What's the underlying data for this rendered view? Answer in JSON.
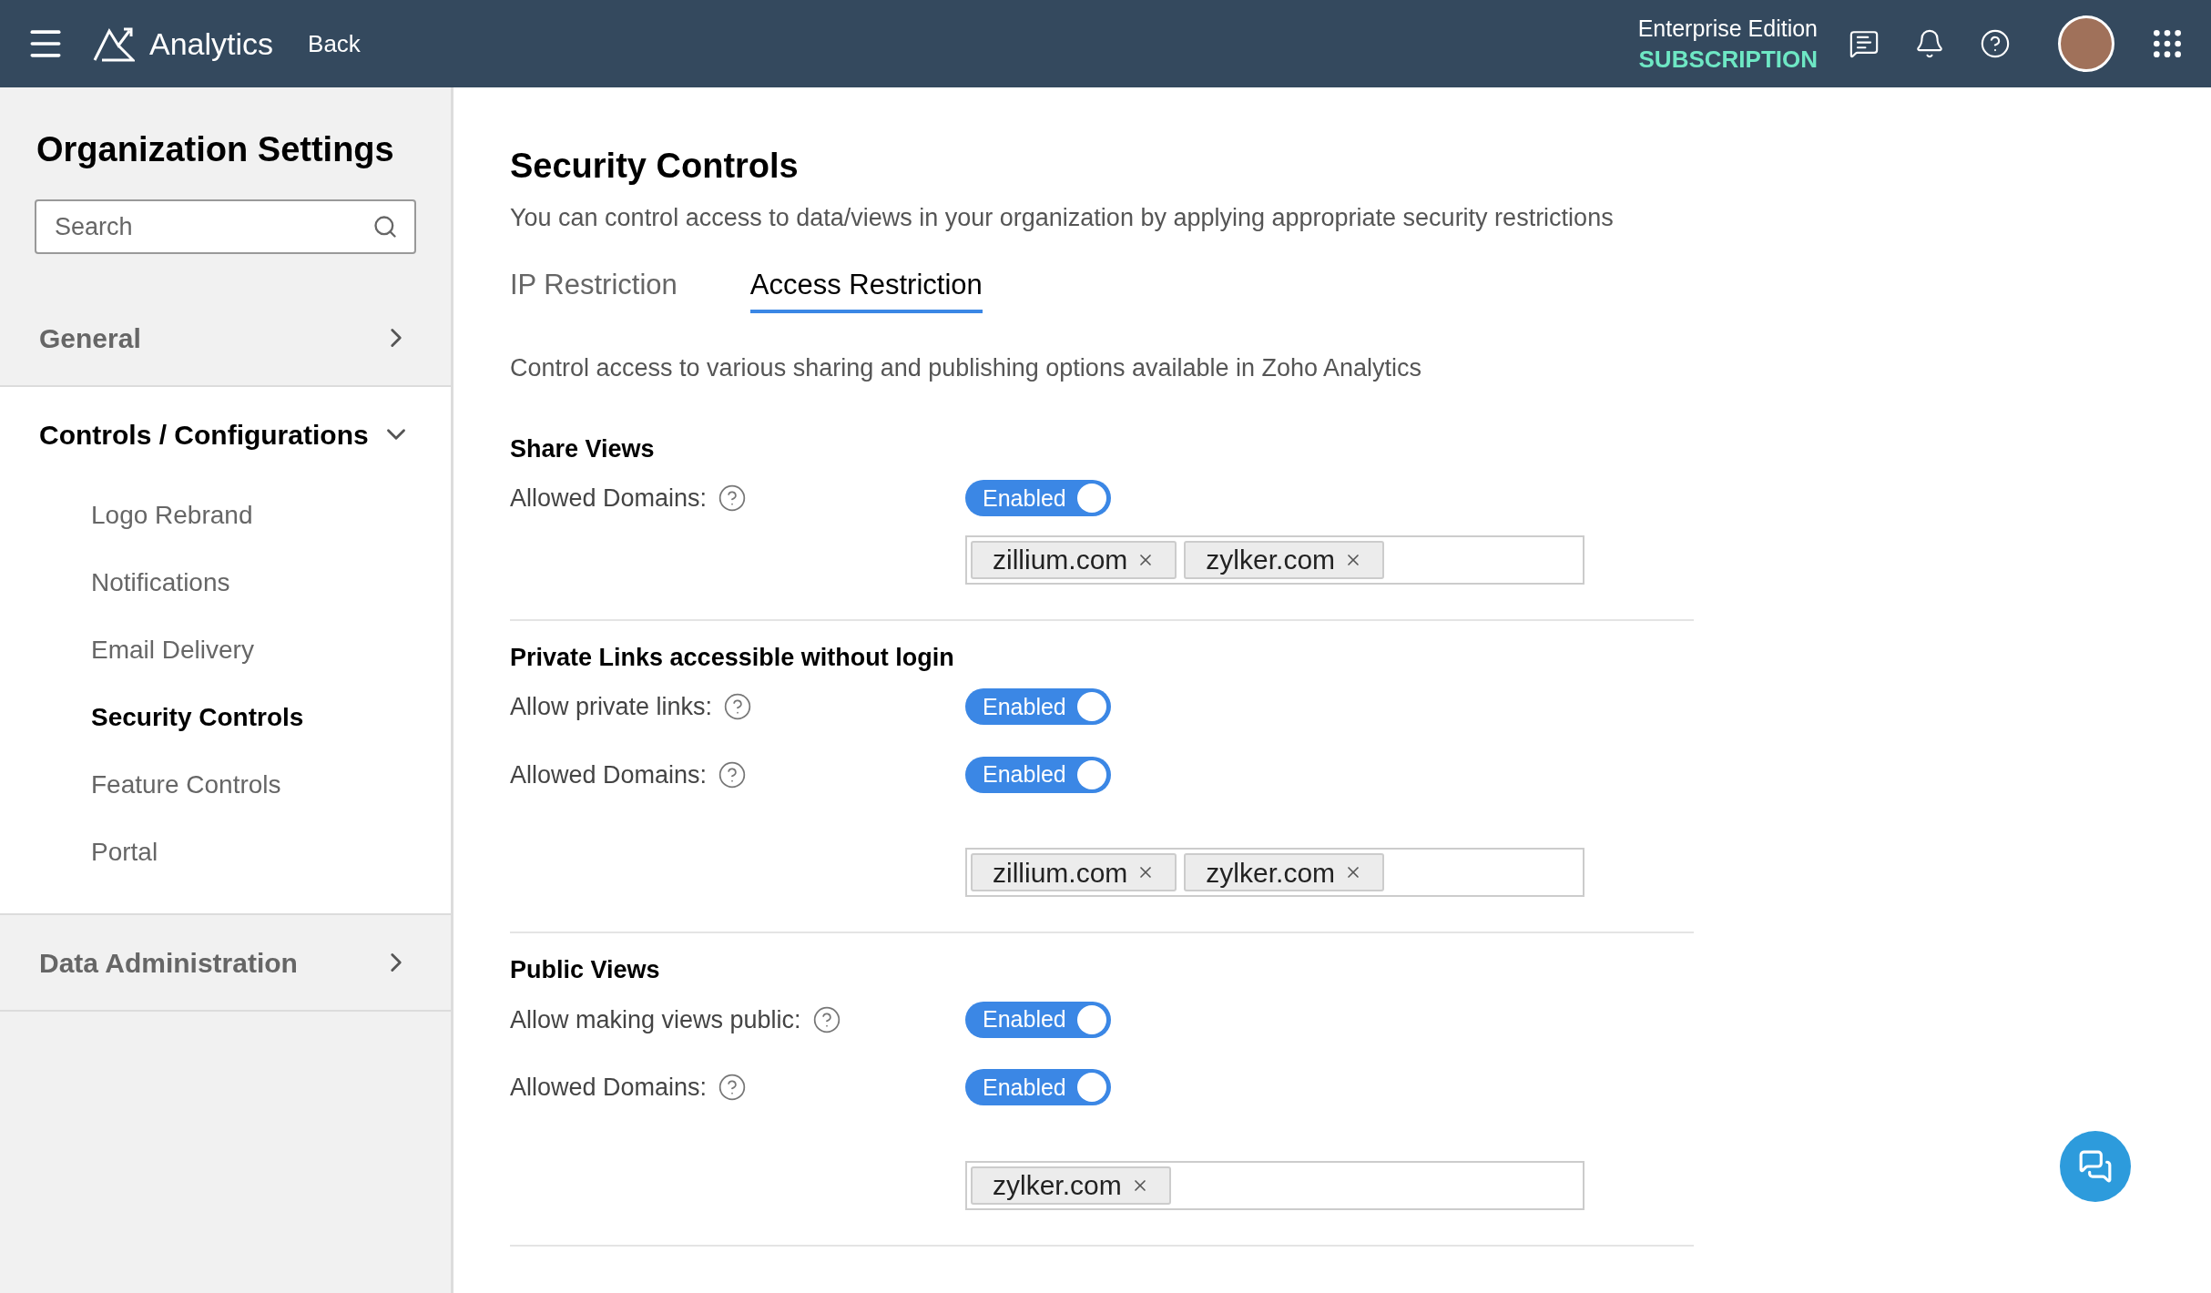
{
  "header": {
    "app_name": "Analytics",
    "back": "Back",
    "edition": "Enterprise Edition",
    "plan": "SUBSCRIPTION"
  },
  "sidebar": {
    "title": "Organization Settings",
    "search": {
      "placeholder": "Search"
    },
    "groups": [
      {
        "label": "General",
        "expanded": false
      },
      {
        "label": "Controls / Configurations",
        "expanded": true,
        "items": [
          {
            "label": "Logo Rebrand",
            "selected": false
          },
          {
            "label": "Notifications",
            "selected": false
          },
          {
            "label": "Email Delivery",
            "selected": false
          },
          {
            "label": "Security Controls",
            "selected": true
          },
          {
            "label": "Feature Controls",
            "selected": false
          },
          {
            "label": "Portal",
            "selected": false
          }
        ]
      },
      {
        "label": "Data Administration",
        "expanded": false
      }
    ]
  },
  "page": {
    "title": "Security Controls",
    "subtitle": "You can control access to data/views in your organization by applying appropriate security restrictions",
    "tabs": [
      {
        "label": "IP Restriction",
        "selected": false
      },
      {
        "label": "Access Restriction",
        "selected": true
      }
    ],
    "description": "Control access to various sharing and publishing options available in Zoho Analytics",
    "sections": [
      {
        "title": "Share Views",
        "rows": [
          {
            "label": "Allowed Domains:",
            "on": true,
            "toggle_text": "Enabled",
            "tags": [
              "zillium.com",
              "zylker.com"
            ]
          }
        ]
      },
      {
        "title": "Private Links accessible without login",
        "rows": [
          {
            "label": "Allow private links:",
            "on": true,
            "toggle_text": "Enabled"
          },
          {
            "label": "Allowed Domains:",
            "on": true,
            "toggle_text": "Enabled",
            "tags": [
              "zillium.com",
              "zylker.com"
            ]
          }
        ]
      },
      {
        "title": "Public Views",
        "rows": [
          {
            "label": "Allow making views public:",
            "on": true,
            "toggle_text": "Enabled"
          },
          {
            "label": "Allowed Domains:",
            "on": true,
            "toggle_text": "Enabled",
            "tags": [
              "zylker.com"
            ]
          }
        ]
      }
    ]
  }
}
